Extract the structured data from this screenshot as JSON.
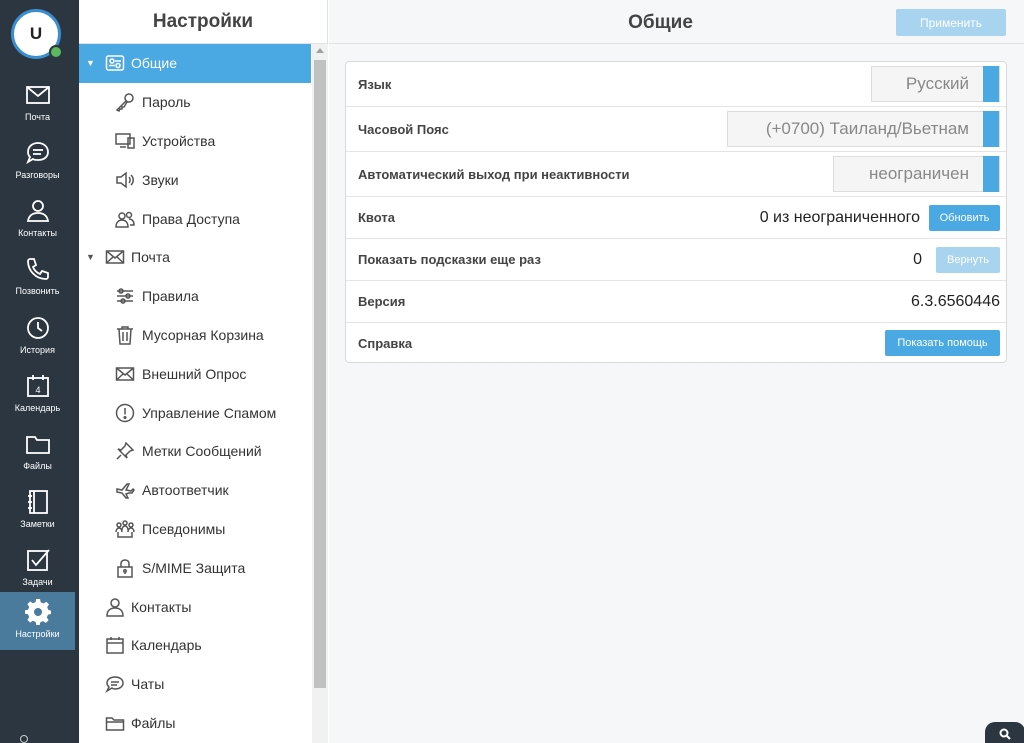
{
  "user": {
    "initial": "U"
  },
  "rail": {
    "items": [
      {
        "label": "Почта",
        "icon": "mail-icon"
      },
      {
        "label": "Разговоры",
        "icon": "chat-icon"
      },
      {
        "label": "Контакты",
        "icon": "contacts-icon"
      },
      {
        "label": "Позвонить",
        "icon": "phone-icon"
      },
      {
        "label": "История",
        "icon": "clock-icon"
      },
      {
        "label": "Календарь",
        "icon": "calendar-icon",
        "badge": "4"
      },
      {
        "label": "Файлы",
        "icon": "folder-icon"
      },
      {
        "label": "Заметки",
        "icon": "notebook-icon"
      },
      {
        "label": "Задачи",
        "icon": "checkbox-icon"
      },
      {
        "label": "Настройки",
        "icon": "gear-icon",
        "active": true
      }
    ]
  },
  "nav": {
    "title": "Настройки",
    "items": [
      {
        "label": "Общие",
        "icon": "settings-switch-icon",
        "level": 1,
        "expandable": true,
        "active": true
      },
      {
        "label": "Пароль",
        "icon": "key-icon",
        "level": 2
      },
      {
        "label": "Устройства",
        "icon": "devices-icon",
        "level": 2
      },
      {
        "label": "Звуки",
        "icon": "speaker-icon",
        "level": 2
      },
      {
        "label": "Права Доступа",
        "icon": "users-icon",
        "level": 2
      },
      {
        "label": "Почта",
        "icon": "envelope-icon",
        "level": 1,
        "expandable": true
      },
      {
        "label": "Правила",
        "icon": "sliders-icon",
        "level": 2
      },
      {
        "label": "Мусорная Корзина",
        "icon": "trash-icon",
        "level": 2
      },
      {
        "label": "Внешний Опрос",
        "icon": "envelope-icon",
        "level": 2
      },
      {
        "label": "Управление Спамом",
        "icon": "alert-icon",
        "level": 2
      },
      {
        "label": "Метки Сообщений",
        "icon": "pin-icon",
        "level": 2
      },
      {
        "label": "Автоответчик",
        "icon": "plane-icon",
        "level": 2
      },
      {
        "label": "Псевдонимы",
        "icon": "group-icon",
        "level": 2
      },
      {
        "label": "S/MIME Защита",
        "icon": "lock-icon",
        "level": 2
      },
      {
        "label": "Контакты",
        "icon": "contact-icon",
        "level": 1
      },
      {
        "label": "Календарь",
        "icon": "calendar-icon",
        "level": 1
      },
      {
        "label": "Чаты",
        "icon": "chat-icon",
        "level": 1
      },
      {
        "label": "Файлы",
        "icon": "folder-icon",
        "level": 1
      }
    ]
  },
  "main": {
    "title": "Общие",
    "apply_label": "Применить",
    "rows": {
      "language": {
        "label": "Язык",
        "value": "Русский"
      },
      "timezone": {
        "label": "Часовой Пояс",
        "value": "(+0700) Таиланд/Вьетнам"
      },
      "autologout": {
        "label": "Автоматический выход при неактивности",
        "value": "неограничен"
      },
      "quota": {
        "label": "Квота",
        "value": "0 из неограниченного",
        "button": "Обновить"
      },
      "tips": {
        "label": "Показать подсказки еще раз",
        "value": "0",
        "button": "Вернуть"
      },
      "version": {
        "label": "Версия",
        "value": "6.3.6560446"
      },
      "help": {
        "label": "Справка",
        "button": "Показать помощь"
      }
    }
  },
  "colors": {
    "accent": "#4aa9e3",
    "rail": "#2b3641",
    "rail_active": "#4a7a9c"
  }
}
